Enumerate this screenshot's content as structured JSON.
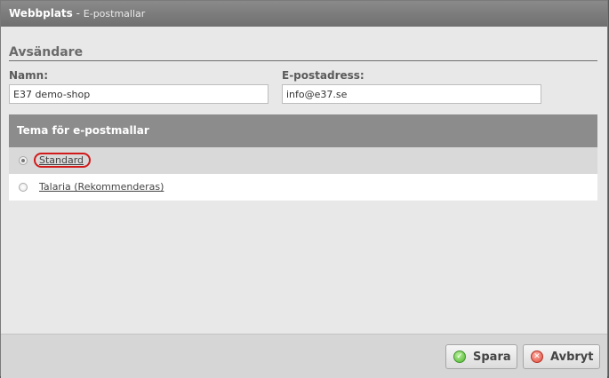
{
  "window": {
    "app": "Webbplats",
    "separator": " - ",
    "subtitle": "E-postmallar"
  },
  "sender": {
    "heading": "Avsändare",
    "name_label": "Namn:",
    "name_value": "E37 demo-shop",
    "email_label": "E-postadress:",
    "email_value": "info@e37.se"
  },
  "themes": {
    "heading": "Tema för e-postmallar",
    "items": [
      {
        "label": "Standard",
        "selected": true
      },
      {
        "label": "Talaria (Rekommenderas)",
        "selected": false
      }
    ]
  },
  "buttons": {
    "save": "Spara",
    "cancel": "Avbryt"
  },
  "colors": {
    "highlight_circle": "#d11a1a",
    "ok_icon": "#4fb52f",
    "cancel_icon": "#de4b3b"
  }
}
